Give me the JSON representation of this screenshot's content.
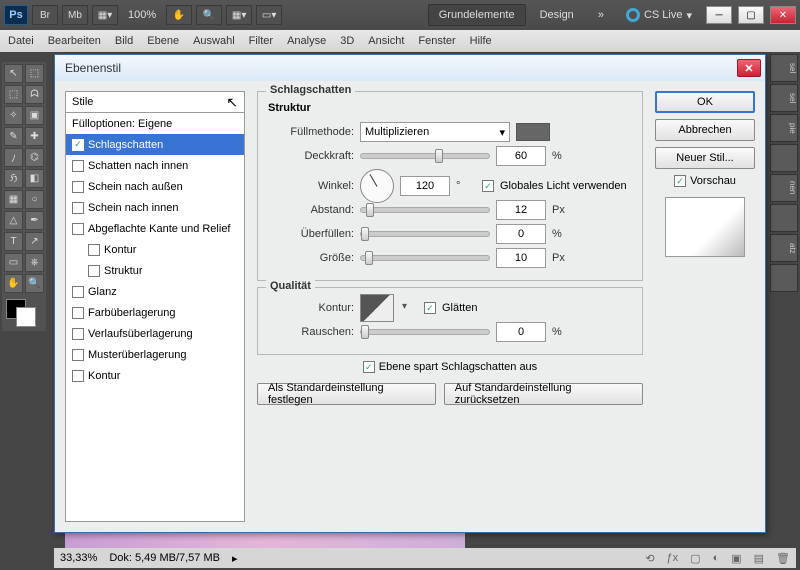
{
  "header": {
    "zoom": "100%",
    "essentials": "Grundelemente",
    "design": "Design",
    "cslive": "CS Live"
  },
  "menu": [
    "Datei",
    "Bearbeiten",
    "Bild",
    "Ebene",
    "Auswahl",
    "Filter",
    "Analyse",
    "3D",
    "Ansicht",
    "Fenster",
    "Hilfe"
  ],
  "dialog": {
    "title": "Ebenenstil",
    "styles_header": "Stile",
    "styles": [
      {
        "label": "Füllоptionen: Eigene",
        "c": null,
        "indent": false
      },
      {
        "label": "Schlagschatten",
        "c": true,
        "sel": true
      },
      {
        "label": "Schatten nach innen",
        "c": false
      },
      {
        "label": "Schein nach außen",
        "c": false
      },
      {
        "label": "Schein nach innen",
        "c": false
      },
      {
        "label": "Abgeflachte Kante und Relief",
        "c": false
      },
      {
        "label": "Kontur",
        "c": false,
        "indent": true
      },
      {
        "label": "Struktur",
        "c": false,
        "indent": true
      },
      {
        "label": "Glanz",
        "c": false
      },
      {
        "label": "Farbüberlagerung",
        "c": false
      },
      {
        "label": "Verlaufsüberlagerung",
        "c": false
      },
      {
        "label": "Musterüberlagerung",
        "c": false
      },
      {
        "label": "Kontur",
        "c": false
      }
    ],
    "panel_title": "Schlagschatten",
    "struktur": "Struktur",
    "fill_lbl": "Füllmethode:",
    "fill_val": "Multiplizieren",
    "opacity_lbl": "Deckkraft:",
    "opacity_val": "60",
    "pct": "%",
    "angle_lbl": "Winkel:",
    "angle_val": "120",
    "deg": "°",
    "global": "Globales Licht verwenden",
    "dist_lbl": "Abstand:",
    "dist_val": "12",
    "px": "Px",
    "spread_lbl": "Überfüllen:",
    "spread_val": "0",
    "size_lbl": "Größe:",
    "size_val": "10",
    "quality": "Qualität",
    "contour_lbl": "Kontur:",
    "aa": "Glätten",
    "noise_lbl": "Rauschen:",
    "noise_val": "0",
    "knock": "Ebene spart Schlagschatten aus",
    "set_default": "Als Standardeinstellung festlegen",
    "reset_default": "Auf Standardeinstellung zurücksetzen",
    "ok": "OK",
    "cancel": "Abbrechen",
    "newstyle": "Neuer Stil...",
    "preview": "Vorschau"
  },
  "status": {
    "zoom": "33,33%",
    "doc": "Dok: 5,49 MB/7,57 MB"
  }
}
